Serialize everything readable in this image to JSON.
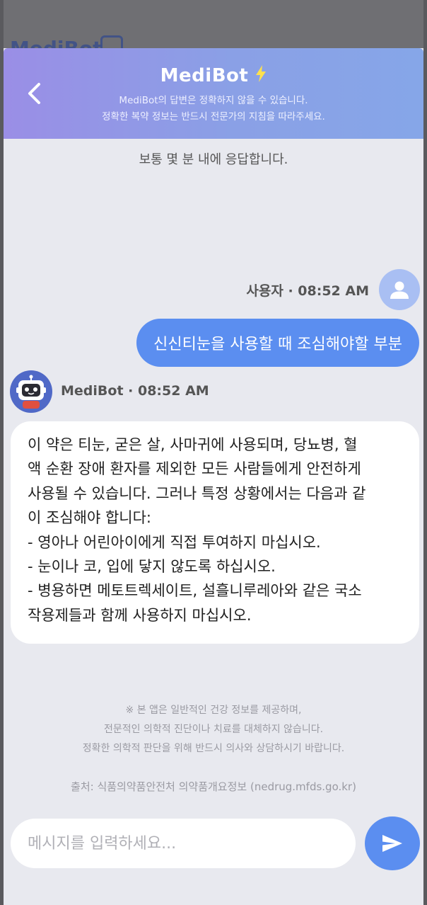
{
  "background_header": {
    "ghost_title": "MediBot"
  },
  "header": {
    "title": "MediBot",
    "subtitle_line1": "MediBot의 답변은 정확하지 않을 수 있습니다.",
    "subtitle_line2": "정확한 복약 정보는 반드시 전문가의 지침을 따라주세요.",
    "back_icon": "chevron-left-icon",
    "title_icon": "lightning-bolt-icon",
    "accent_color": "#FFE14D"
  },
  "response_note": "보통 몇 분 내에 응답합니다.",
  "messages": [
    {
      "sender": "user",
      "meta": "사용자 · 08:52 AM",
      "text": "신신티눈을 사용할 때 조심해야할 부분",
      "avatar_icon": "person-icon"
    },
    {
      "sender": "bot",
      "meta": "MediBot · 08:52 AM",
      "avatar_icon": "robot-icon",
      "lines": [
        "이 약은 티눈, 굳은 살, 사마귀에 사용되며, 당뇨병, 혈",
        "액 순환 장애 환자를 제외한 모든 사람들에게 안전하게",
        "사용될 수 있습니다. 그러나 특정 상황에서는 다음과 같",
        "이 조심해야 합니다:",
        "- 영아나 어린아이에게 직접 투여하지 마십시오.",
        "- 눈이나 코, 입에 닿지 않도록 하십시오.",
        "- 병용하면 메토트렉세이트, 설흘니루레아와 같은 국소",
        "작용제들과 함께 사용하지 마십시오."
      ]
    }
  ],
  "disclaimer": {
    "line1": "※ 본 앱은 일반적인 건강 정보를 제공하며,",
    "line2": "전문적인 의학적 진단이나 치료를 대체하지 않습니다.",
    "line3": "정확한 의학적 판단을 위해 반드시 의사와 상담하시기 바랍니다.",
    "source": "출처: 식품의약품안전처 의약품개요정보 (nedrug.mfds.go.kr)"
  },
  "input": {
    "placeholder": "메시지를 입력하세요...",
    "value": "",
    "send_icon": "send-icon"
  },
  "colors": {
    "user_bubble": "#5B8EF0",
    "send_button": "#5B8EF0",
    "bot_avatar": "#5069C7",
    "user_avatar": "#A9BFF3"
  }
}
